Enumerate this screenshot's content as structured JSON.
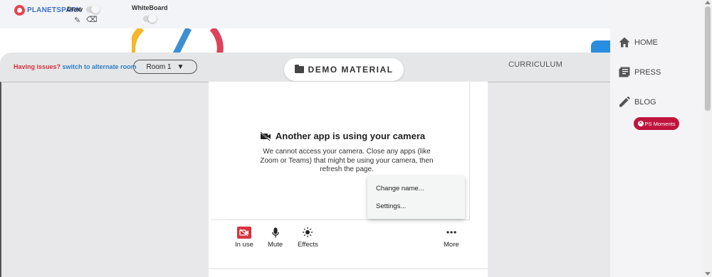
{
  "toolbar": {
    "logo_text": "PLANETSPARK",
    "draw_label": "Draw",
    "whiteboard_label": "WhiteBoard"
  },
  "room_bar": {
    "issues_text": "Having issues?",
    "alternate_link": "switch to alternate room",
    "room_selected": "Room 1",
    "room_arrow": "▼",
    "demo_label": "DEMO MATERIAL",
    "curriculum_label": "CURRICULUM"
  },
  "camera": {
    "title": "Another app is using your camera",
    "description": "We cannot access your camera. Close any apps (like Zoom or Teams) that might be using your camera, then refresh the page."
  },
  "context_menu": {
    "items": [
      "Change name...",
      "Settings..."
    ]
  },
  "controls": {
    "in_use": "In use",
    "mute": "Mute",
    "effects": "Effects",
    "more": "More"
  },
  "sidebar": {
    "home": "HOME",
    "press": "PRESS",
    "blog": "BLOG",
    "ps_moments": "PS Moments"
  },
  "colors": {
    "accent_red": "#c0143c",
    "link_blue": "#2f7fc6",
    "camera_red": "#d8333f"
  }
}
